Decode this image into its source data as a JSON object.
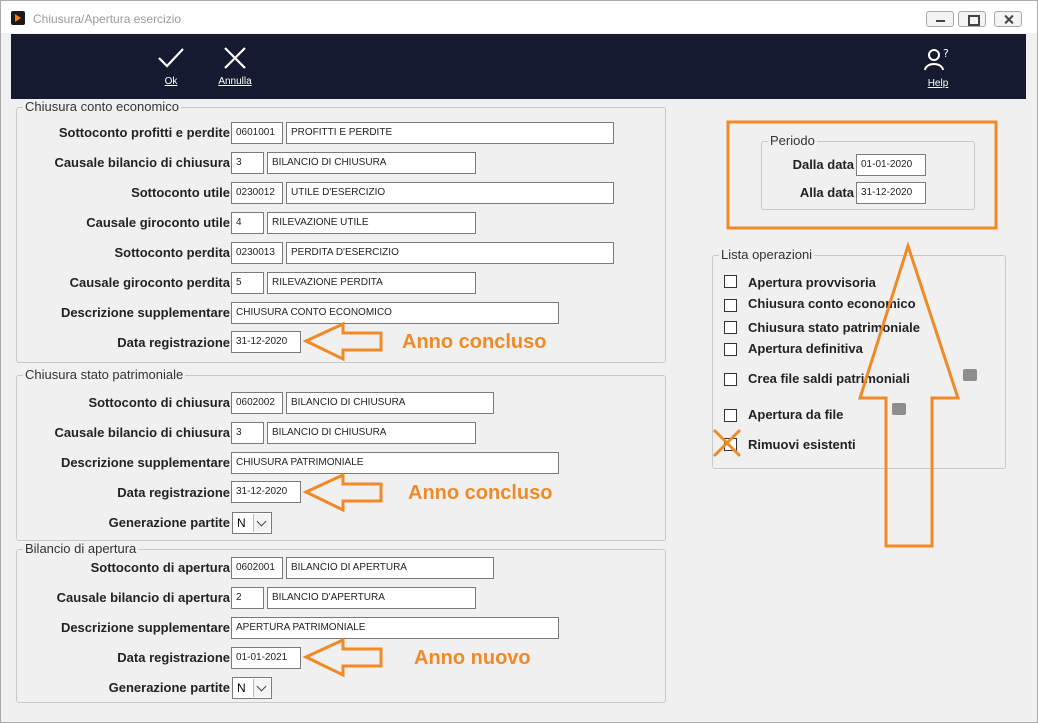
{
  "window": {
    "title": "Chiusura/Apertura esercizio"
  },
  "toolbar": {
    "ok_label": "Ok",
    "cancel_label": "Annulla",
    "help_label": "Help"
  },
  "chiusura_ce": {
    "legend": "Chiusura conto economico",
    "rows": [
      {
        "label": "Sottoconto profitti e perdite",
        "code": "0601001",
        "desc": "PROFITTI E PERDITE"
      },
      {
        "label": "Causale bilancio di chiusura",
        "code": "3",
        "desc": "BILANCIO DI CHIUSURA"
      },
      {
        "label": "Sottoconto utile",
        "code": "0230012",
        "desc": "UTILE D'ESERCIZIO"
      },
      {
        "label": "Causale giroconto utile",
        "code": "4",
        "desc": "RILEVAZIONE UTILE"
      },
      {
        "label": "Sottoconto perdita",
        "code": "0230013",
        "desc": "PERDITA D'ESERCIZIO"
      },
      {
        "label": "Causale giroconto perdita",
        "code": "5",
        "desc": "RILEVAZIONE PERDITA"
      }
    ],
    "desc_supp_label": "Descrizione supplementare",
    "desc_supp_value": "CHIUSURA CONTO ECONOMICO",
    "data_reg_label": "Data registrazione",
    "data_reg_value": "31-12-2020"
  },
  "chiusura_sp": {
    "legend": "Chiusura stato patrimoniale",
    "rows": [
      {
        "label": "Sottoconto di chiusura",
        "code": "0602002",
        "desc": "BILANCIO DI CHIUSURA"
      },
      {
        "label": "Causale bilancio di chiusura",
        "code": "3",
        "desc": "BILANCIO DI CHIUSURA"
      }
    ],
    "desc_supp_label": "Descrizione supplementare",
    "desc_supp_value": "CHIUSURA PATRIMONIALE",
    "data_reg_label": "Data registrazione",
    "data_reg_value": "31-12-2020",
    "gen_label": "Generazione partite",
    "gen_value": "N"
  },
  "apertura": {
    "legend": "Bilancio di apertura",
    "rows": [
      {
        "label": "Sottoconto di apertura",
        "code": "0602001",
        "desc": "BILANCIO DI APERTURA"
      },
      {
        "label": "Causale bilancio di apertura",
        "code": "2",
        "desc": "BILANCIO D'APERTURA"
      }
    ],
    "desc_supp_label": "Descrizione supplementare",
    "desc_supp_value": "APERTURA PATRIMONIALE",
    "data_reg_label": "Data registrazione",
    "data_reg_value": "01-01-2021",
    "gen_label": "Generazione partite",
    "gen_value": "N"
  },
  "periodo": {
    "legend": "Periodo",
    "dalla_label": "Dalla data",
    "dalla_value": "01-01-2020",
    "alla_label": "Alla data",
    "alla_value": "31-12-2020"
  },
  "operazioni": {
    "legend": "Lista operazioni",
    "items": [
      {
        "label": "Apertura provvisoria"
      },
      {
        "label": "Chiusura conto economico"
      },
      {
        "label": "Chiusura stato patrimoniale"
      },
      {
        "label": "Apertura definitiva"
      },
      {
        "label": "Crea file saldi patrimoniali"
      },
      {
        "label": "Apertura da file"
      },
      {
        "label": "Rimuovi esistenti"
      }
    ]
  },
  "annotations": {
    "note_1": "Anno concluso",
    "note_2": "Anno concluso",
    "note_3": "Anno nuovo",
    "color": "#f08a26"
  }
}
